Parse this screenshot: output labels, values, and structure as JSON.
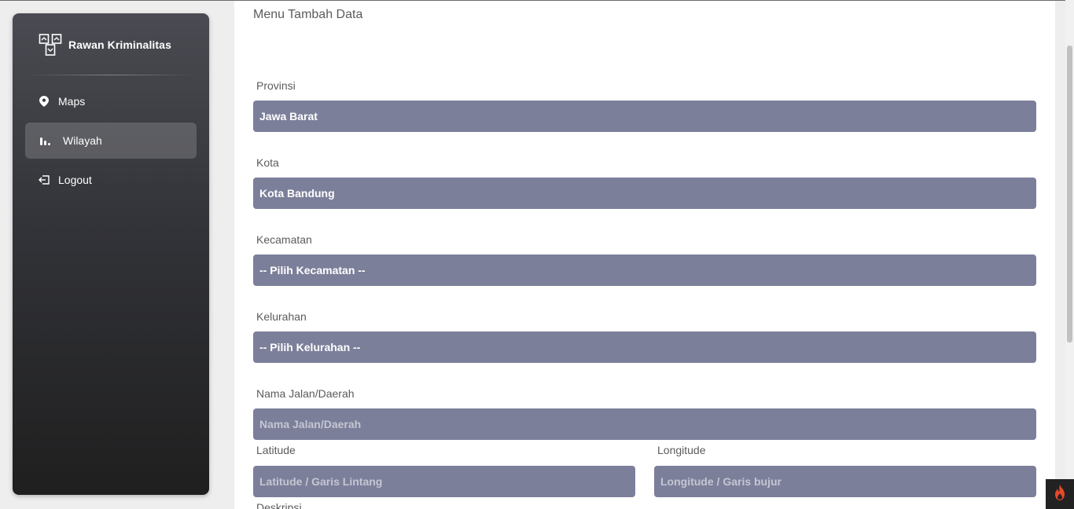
{
  "sidebar": {
    "brand": "Rawan Kriminalitas",
    "items": [
      {
        "label": "Maps",
        "icon": "map-pin-icon"
      },
      {
        "label": "Wilayah",
        "icon": "bar-chart-icon",
        "active": true
      },
      {
        "label": "Logout",
        "icon": "logout-icon"
      }
    ]
  },
  "main": {
    "title": "Menu Tambah Data",
    "form": {
      "provinsi": {
        "label": "Provinsi",
        "value": "Jawa Barat"
      },
      "kota": {
        "label": "Kota",
        "value": "Kota Bandung"
      },
      "kecamatan": {
        "label": "Kecamatan",
        "value": "-- Pilih Kecamatan --"
      },
      "kelurahan": {
        "label": "Kelurahan",
        "value": "-- Pilih Kelurahan --"
      },
      "jalan": {
        "label": "Nama Jalan/Daerah",
        "placeholder": "Nama Jalan/Daerah"
      },
      "latitude": {
        "label": "Latitude",
        "placeholder": "Latitude / Garis Lintang"
      },
      "longitude": {
        "label": "Longitude",
        "placeholder": "Longitude / Garis bujur"
      },
      "deskripsi": {
        "label": "Deskripsi"
      }
    }
  },
  "colors": {
    "field_bg": "#7c7f9a",
    "sidebar_top": "#4a4b52",
    "sidebar_bottom": "#1f1f1f"
  }
}
